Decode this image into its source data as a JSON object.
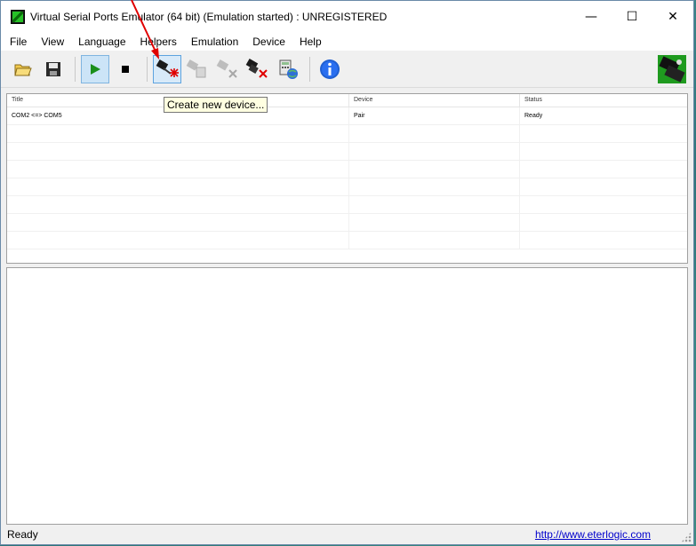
{
  "window": {
    "title": "Virtual Serial Ports Emulator (64 bit) (Emulation started) : UNREGISTERED",
    "controls": {
      "minimize": "—",
      "maximize": "☐",
      "close": "✕"
    }
  },
  "menu": [
    "File",
    "View",
    "Language",
    "Helpers",
    "Emulation",
    "Device",
    "Help"
  ],
  "toolbar": {
    "tooltip": "Create new device...",
    "buttons": [
      {
        "name": "open-icon",
        "state": "normal"
      },
      {
        "name": "save-icon",
        "state": "normal"
      },
      {
        "name": "start-emulation-icon",
        "state": "pressed"
      },
      {
        "name": "stop-emulation-icon",
        "state": "normal"
      },
      {
        "name": "create-device-icon",
        "state": "hover"
      },
      {
        "name": "edit-device-icon",
        "state": "disabled"
      },
      {
        "name": "delete-device-icon",
        "state": "disabled"
      },
      {
        "name": "delete-all-devices-icon",
        "state": "normal"
      },
      {
        "name": "port-info-icon",
        "state": "normal"
      },
      {
        "name": "about-icon",
        "state": "normal"
      }
    ],
    "accent_colors": {
      "play": "#1a8f1a",
      "info": "#1f5fd1",
      "delete": "#e00000"
    }
  },
  "devices_table": {
    "columns": [
      "Title",
      "Device",
      "Status"
    ],
    "rows": [
      {
        "title": "COM2 <=> COM5",
        "device": "Pair",
        "status": "Ready"
      }
    ]
  },
  "status": {
    "text": "Ready",
    "link": "http://www.eterlogic.com"
  }
}
